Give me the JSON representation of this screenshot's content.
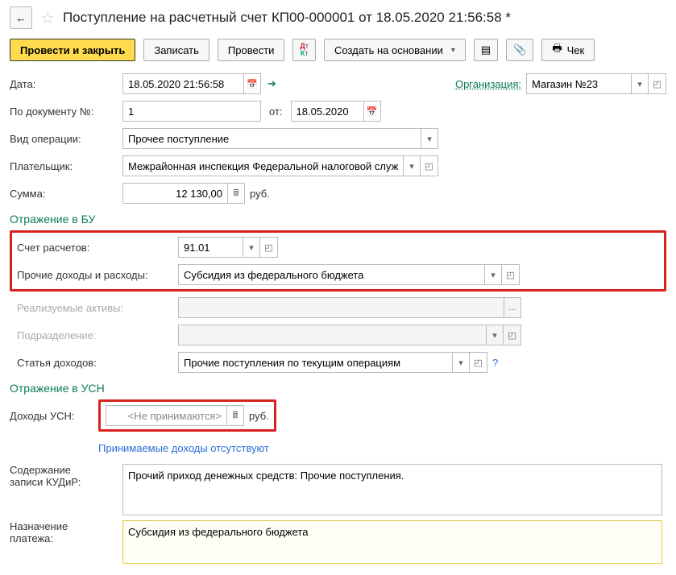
{
  "header": {
    "title": "Поступление на расчетный счет КП00-000001 от 18.05.2020 21:56:58 *"
  },
  "toolbar": {
    "post_close": "Провести и закрыть",
    "save": "Записать",
    "post": "Провести",
    "create_basis": "Создать на основании",
    "check": "Чек"
  },
  "labels": {
    "date": "Дата:",
    "organization": "Организация:",
    "doc_no": "По документу №:",
    "from": "от:",
    "op_type": "Вид операции:",
    "payer": "Плательщик:",
    "amount": "Сумма:",
    "currency": "руб.",
    "section_bu": "Отражение в БУ",
    "settlement_account": "Счет расчетов:",
    "other_income": "Прочие доходы и расходы:",
    "assets": "Реализуемые активы:",
    "division": "Подразделение:",
    "income_item": "Статья доходов:",
    "section_usn": "Отражение в УСН",
    "usn_income": "Доходы УСН:",
    "usn_note": "Принимаемые доходы отсутствуют",
    "kudir": "Содержание\nзаписи КУДиР:",
    "purpose": "Назначение\nплатежа:"
  },
  "values": {
    "date": "18.05.2020 21:56:58",
    "organization": "Магазин №23",
    "doc_no": "1",
    "doc_date": "18.05.2020",
    "op_type": "Прочее поступление",
    "payer": "Межрайонная инспекция Федеральной налоговой службы",
    "amount": "12 130,00",
    "settlement_account": "91.01",
    "other_income": "Субсидия из федерального бюджета",
    "assets": "",
    "division": "",
    "income_item": "Прочие поступления по текущим операциям",
    "usn_income": "<Не принимаются>",
    "kudir": "Прочий приход денежных средств: Прочие поступления.",
    "purpose": "Субсидия из федерального бюджета"
  },
  "icons": {
    "calendar": "📅",
    "calc": "🖩",
    "dropdown": "▾",
    "expand": "◰",
    "more": "...",
    "help": "?",
    "clip": "📎",
    "struct": "▤",
    "arrow_next": "➔"
  }
}
